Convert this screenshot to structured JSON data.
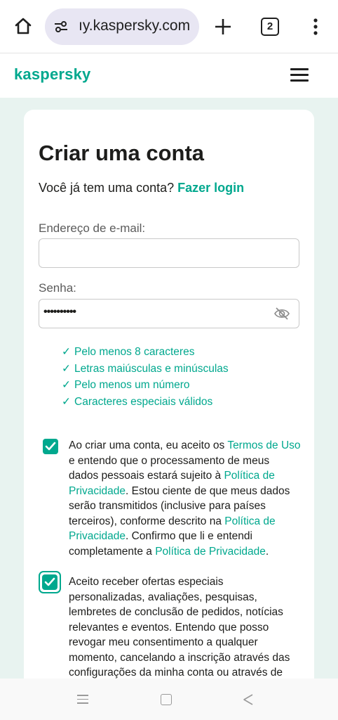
{
  "browser": {
    "url": "ıy.kaspersky.com",
    "tab_count": "2"
  },
  "site": {
    "logo": "kaspersky"
  },
  "form": {
    "title": "Criar uma conta",
    "have_account": "Você já tem uma conta?",
    "login_link": "Fazer login",
    "email_label": "Endereço de e-mail:",
    "email_value": "",
    "password_label": "Senha:",
    "password_value": "••••••••••",
    "requirements": [
      "Pelo menos 8 caracteres",
      "Letras maiúsculas e minúsculas",
      "Pelo menos um número",
      "Caracteres especiais válidos"
    ],
    "consent1": {
      "checked": true,
      "t1": "Ao criar uma conta, eu aceito os ",
      "l1": "Termos de Uso",
      "t2": " e entendo que o processamento de meus dados pessoais estará sujeito à ",
      "l2": "Política de Privacidade",
      "t3": ". Estou ciente de que meus dados serão transmitidos (inclusive para países terceiros), conforme descrito na ",
      "l3": "Política de Privacidade",
      "t4": ". Confirmo que li e entendi completamente a ",
      "l4": "Política de Privacidade",
      "t5": "."
    },
    "consent2": {
      "checked": true,
      "text": "Aceito receber ofertas especiais personalizadas, avaliações, pesquisas, lembretes de conclusão de pedidos, notícias relevantes e eventos. Entendo que posso revogar meu consentimento a qualquer momento, cancelando a inscrição através das configurações da minha conta ou através de"
    }
  },
  "colors": {
    "accent": "#00a88e",
    "page_bg": "#e8f3f0",
    "url_pill": "#e8e6f3"
  },
  "icons": [
    "home-icon",
    "tune-icon",
    "plus-icon",
    "tabs-icon",
    "more-vert-icon",
    "menu-icon",
    "eye-off-icon",
    "check-icon",
    "checkbox-checked-icon",
    "nav-recent-icon",
    "nav-home-icon",
    "nav-back-icon"
  ]
}
